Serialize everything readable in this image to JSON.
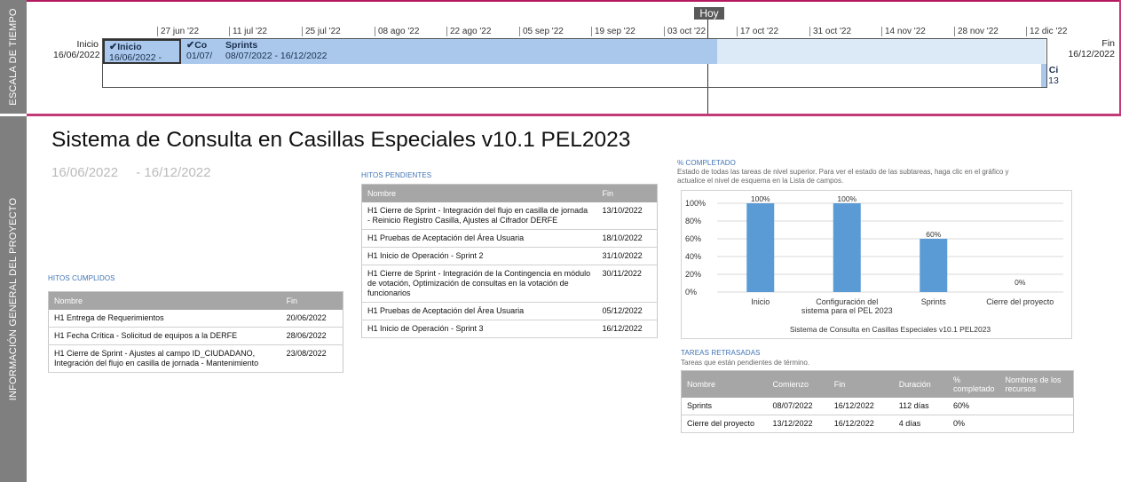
{
  "timeline": {
    "side_label": "ESCALA DE TIEMPO",
    "today_label": "Hoy",
    "start": {
      "label": "Inicio",
      "date": "16/06/2022"
    },
    "end": {
      "label": "Fin",
      "date": "16/12/2022"
    },
    "ticks": [
      "27 jun '22",
      "11 jul '22",
      "25 jul '22",
      "08 ago '22",
      "22 ago '22",
      "05 sep '22",
      "19 sep '22",
      "03 oct '22",
      "17 oct '22",
      "31 oct '22",
      "14 nov '22",
      "28 nov '22",
      "12 dic '22"
    ],
    "tasks": [
      {
        "name": "Inicio",
        "dates": "16/06/2022 -"
      },
      {
        "name": "Co",
        "dates": "01/07/"
      },
      {
        "name": "Sprints",
        "dates": "08/07/2022 - 16/12/2022"
      },
      {
        "name": "Ci",
        "dates": "13"
      }
    ]
  },
  "project": {
    "side_label": "INFORMACIÓN GENERAL DEL PROYECTO",
    "title": "Sistema de Consulta en Casillas Especiales v10.1 PEL2023",
    "start_date": "16/06/2022",
    "end_date": "- 16/12/2022"
  },
  "hitos_cumplidos": {
    "label": "HITOS CUMPLIDOS",
    "headers": [
      "Nombre",
      "Fin"
    ],
    "rows": [
      [
        "H1 Entrega de Requerimientos",
        "20/06/2022"
      ],
      [
        "H1 Fecha Crítica - Solicitud de equipos a la DERFE",
        "28/06/2022"
      ],
      [
        "H1 Cierre de Sprint - Ajustes al campo ID_CIUDADANO, Integración del flujo en casilla de jornada - Mantenimiento",
        "23/08/2022"
      ]
    ]
  },
  "hitos_pendientes": {
    "label": "HITOS PENDIENTES",
    "headers": [
      "Nombre",
      "Fin"
    ],
    "rows": [
      [
        "H1 Cierre de Sprint - Integración del flujo en casilla de jornada - Reinicio Registro Casilla, Ajustes al Cifrador DERFE",
        "13/10/2022"
      ],
      [
        "H1 Pruebas de Aceptación del Área Usuaria",
        "18/10/2022"
      ],
      [
        "H1 Inicio de Operación - Sprint 2",
        "31/10/2022"
      ],
      [
        "H1 Cierre de Sprint - Integración de la Contingencia en módulo de votación, Optimización de consultas en la votación de funcionarios",
        "30/11/2022"
      ],
      [
        "H1 Pruebas de Aceptación del Área Usuaria",
        "05/12/2022"
      ],
      [
        "H1 Inicio de Operación - Sprint 3",
        "16/12/2022"
      ]
    ]
  },
  "completado": {
    "label": "% COMPLETADO",
    "description": "Estado de todas las tareas de nivel superior. Para ver el estado de las subtareas, haga clic en el gráfico y actualice el nivel de esquema en la Lista de campos."
  },
  "chart_data": {
    "type": "bar",
    "categories": [
      "Inicio",
      "Configuración del sistema para el PEL 2023",
      "Sprints",
      "Cierre del proyecto"
    ],
    "category_lines": [
      [
        "Inicio"
      ],
      [
        "Configuración del",
        "sistema para el PEL 2023"
      ],
      [
        "Sprints"
      ],
      [
        "Cierre del proyecto"
      ]
    ],
    "values": [
      100,
      100,
      60,
      0
    ],
    "data_labels": [
      "100%",
      "100%",
      "60%",
      "0%"
    ],
    "yticks": [
      "100%",
      "80%",
      "60%",
      "40%",
      "20%",
      "0%"
    ],
    "ylim": [
      0,
      100
    ],
    "xlabel": "Sistema de Consulta en Casillas Especiales v10.1 PEL2023",
    "bar_color": "#5b9bd5",
    "grid": true
  },
  "tareas_retrasadas": {
    "label": "TAREAS RETRASADAS",
    "description": "Tareas que están pendientes de término.",
    "headers": [
      "Nombre",
      "Comienzo",
      "Fin",
      "Duración",
      "% completado",
      "Nombres de los recursos"
    ],
    "rows": [
      [
        "Sprints",
        "08/07/2022",
        "16/12/2022",
        "112 días",
        "60%",
        ""
      ],
      [
        "Cierre del proyecto",
        "13/12/2022",
        "16/12/2022",
        "4 días",
        "0%",
        ""
      ]
    ]
  }
}
